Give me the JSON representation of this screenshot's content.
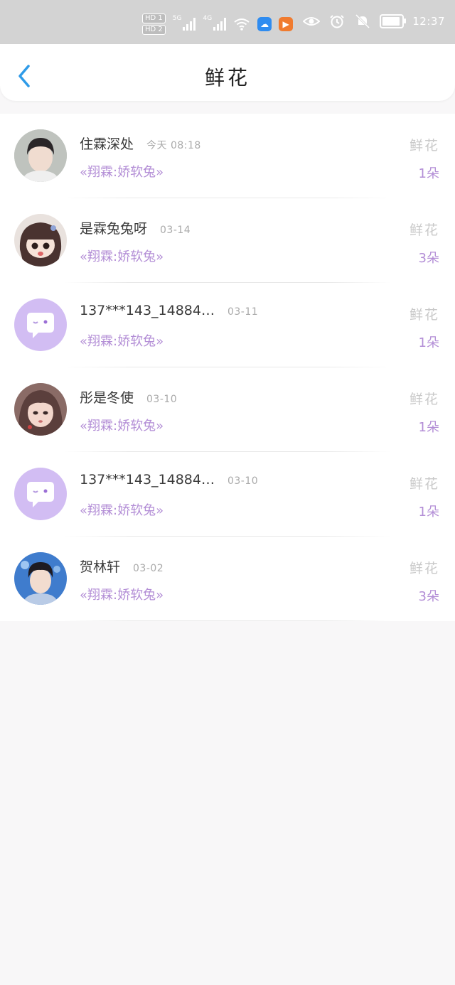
{
  "status_bar": {
    "hd1": "HD 1",
    "hd2": "HD 2",
    "net1": "5G",
    "net2": "4G",
    "time": "12:37",
    "icons": [
      "hd-icon",
      "signal-icon",
      "wifi-icon",
      "cloud-app-icon",
      "video-app-icon",
      "eye-icon",
      "alarm-icon",
      "mute-bell-icon",
      "battery-icon"
    ],
    "colors": {
      "cloud_app": "#2f8cf0",
      "video_app": "#f07b2f"
    }
  },
  "header": {
    "title": "鲜花"
  },
  "list": [
    {
      "name": "住霖深处",
      "date": "今天 08:18",
      "sub": "«翔霖:娇软兔»",
      "type": "鲜花",
      "count": "1朵",
      "avatar": "photo"
    },
    {
      "name": "是霖兔兔呀",
      "date": "03-14",
      "sub": "«翔霖:娇软兔»",
      "type": "鲜花",
      "count": "3朵",
      "avatar": "cartoon"
    },
    {
      "name": "137***143_14884…",
      "date": "03-11",
      "sub": "«翔霖:娇软兔»",
      "type": "鲜花",
      "count": "1朵",
      "avatar": "default"
    },
    {
      "name": "彤是冬使",
      "date": "03-10",
      "sub": "«翔霖:娇软兔»",
      "type": "鲜花",
      "count": "1朵",
      "avatar": "illustration"
    },
    {
      "name": "137***143_14884…",
      "date": "03-10",
      "sub": "«翔霖:娇软兔»",
      "type": "鲜花",
      "count": "1朵",
      "avatar": "default"
    },
    {
      "name": "贺林轩",
      "date": "03-02",
      "sub": "«翔霖:娇软兔»",
      "type": "鲜花",
      "count": "3朵",
      "avatar": "photo2"
    }
  ],
  "colors": {
    "accent": "#b38ed6",
    "back_arrow": "#2f9be8",
    "default_avatar": "#d2bdf3"
  }
}
